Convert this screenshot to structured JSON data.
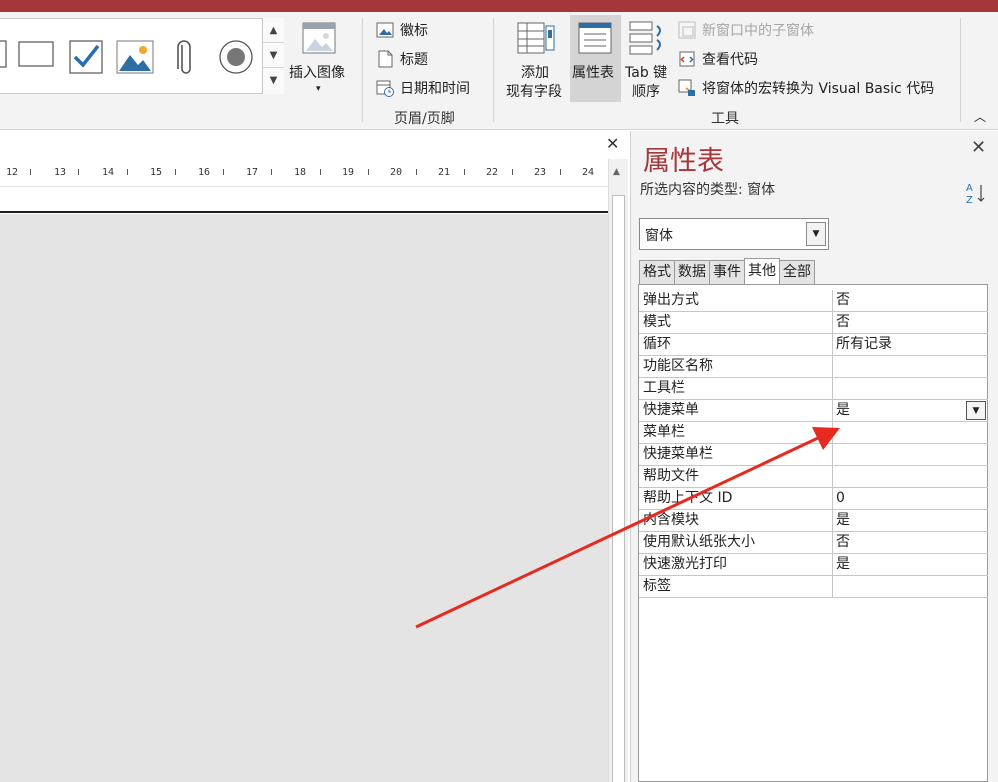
{
  "ribbon": {
    "insert_image": "插入图像",
    "header_footer_items": [
      "徽标",
      "标题",
      "日期和时间"
    ],
    "header_footer_group": "页眉/页脚",
    "add_fields_line1": "添加",
    "add_fields_line2": "现有字段",
    "property_sheet": "属性表",
    "tab_order_line1": "Tab 键",
    "tab_order_line2": "顺序",
    "subform_new_window": "新窗口中的子窗体",
    "view_code": "查看代码",
    "convert_macros": "将窗体的宏转换为 Visual Basic 代码",
    "tools_group": "工具"
  },
  "ruler": {
    "ticks": [
      "12",
      "13",
      "14",
      "15",
      "16",
      "17",
      "18",
      "19",
      "20",
      "21",
      "22",
      "23",
      "24"
    ]
  },
  "property_sheet": {
    "title": "属性表",
    "selection_type": "所选内容的类型: 窗体",
    "object": "窗体",
    "tabs": [
      "格式",
      "数据",
      "事件",
      "其他",
      "全部"
    ],
    "active_tab": "其他",
    "rows": [
      {
        "name": "弹出方式",
        "value": "否"
      },
      {
        "name": "模式",
        "value": "否"
      },
      {
        "name": "循环",
        "value": "所有记录"
      },
      {
        "name": "功能区名称",
        "value": ""
      },
      {
        "name": "工具栏",
        "value": ""
      },
      {
        "name": "快捷菜单",
        "value": "是"
      },
      {
        "name": "菜单栏",
        "value": ""
      },
      {
        "name": "快捷菜单栏",
        "value": ""
      },
      {
        "name": "帮助文件",
        "value": ""
      },
      {
        "name": "帮助上下文 ID",
        "value": "0"
      },
      {
        "name": "内含模块",
        "value": "是"
      },
      {
        "name": "使用默认纸张大小",
        "value": "否"
      },
      {
        "name": "快速激光打印",
        "value": "是"
      },
      {
        "name": "标签",
        "value": ""
      }
    ]
  },
  "colors": {
    "accent": "#a4373a",
    "annotation_arrow": "#e8291f"
  }
}
